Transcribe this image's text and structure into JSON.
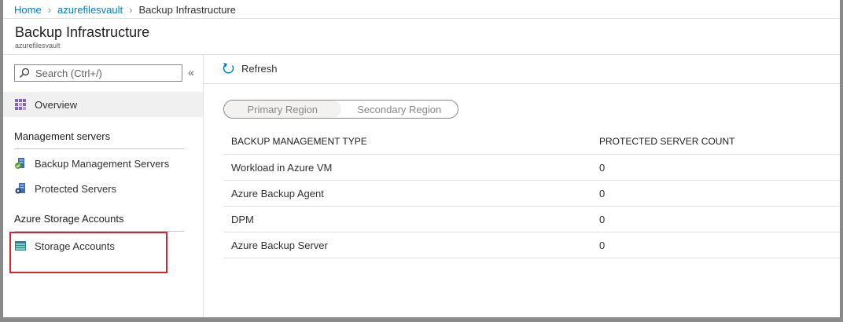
{
  "breadcrumb": {
    "home": "Home",
    "vault": "azurefilesvault",
    "current": "Backup Infrastructure"
  },
  "page": {
    "title": "Backup Infrastructure",
    "subtitle": "azurefilesvault"
  },
  "sidebar": {
    "search_placeholder": "Search (Ctrl+/)",
    "collapse": "«",
    "overview": "Overview",
    "sections": [
      {
        "title": "Management servers",
        "items": [
          {
            "label": "Backup Management Servers",
            "icon": "backup-server-icon"
          },
          {
            "label": "Protected Servers",
            "icon": "protected-server-icon"
          }
        ]
      },
      {
        "title": "Azure Storage Accounts",
        "items": [
          {
            "label": "Storage Accounts",
            "icon": "storage-account-icon"
          }
        ]
      }
    ]
  },
  "toolbar": {
    "refresh": "Refresh"
  },
  "region": {
    "primary": "Primary Region",
    "secondary": "Secondary Region",
    "selected": "primary"
  },
  "table": {
    "headers": [
      "BACKUP MANAGEMENT TYPE",
      "PROTECTED SERVER COUNT"
    ],
    "rows": [
      [
        "Workload in Azure VM",
        "0"
      ],
      [
        "Azure Backup Agent",
        "0"
      ],
      [
        "DPM",
        "0"
      ],
      [
        "Azure Backup Server",
        "0"
      ]
    ]
  },
  "colors": {
    "accent": "#0078d4",
    "highlight": "#d9232e"
  }
}
